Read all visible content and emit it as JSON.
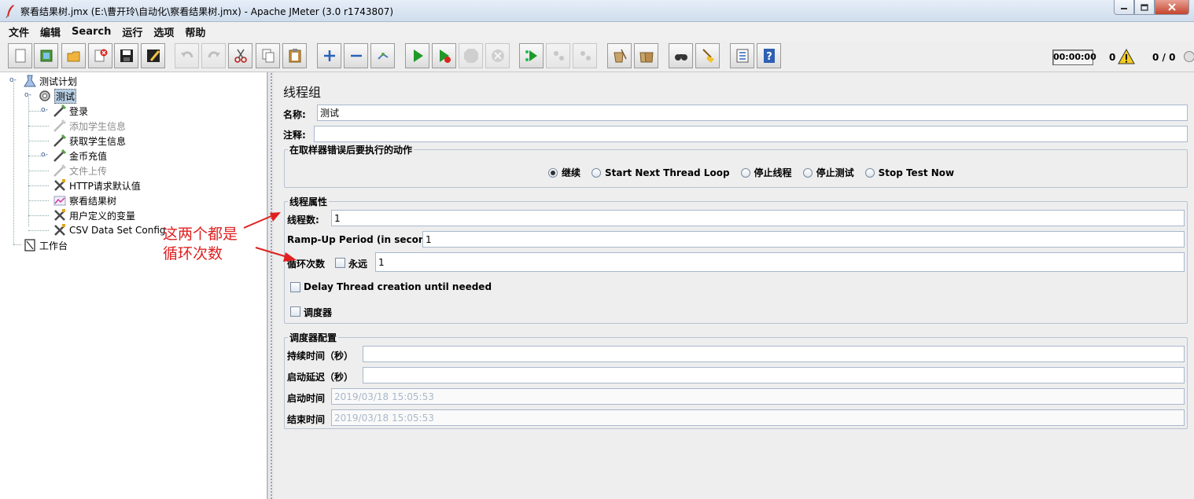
{
  "window": {
    "title": "察看结果树.jmx (E:\\曹开玲\\自动化\\察看结果树.jmx) - Apache JMeter (3.0 r1743807)",
    "minimize_icon": "minimize-icon",
    "maximize_icon": "maximize-icon",
    "close_icon": "close-icon"
  },
  "menu": [
    "文件",
    "编辑",
    "Search",
    "运行",
    "选项",
    "帮助"
  ],
  "toolbar": {
    "buttons": [
      {
        "name": "new-icon",
        "enabled": true
      },
      {
        "name": "templates-icon",
        "enabled": true
      },
      {
        "name": "open-icon",
        "enabled": true
      },
      {
        "name": "close-plan-icon",
        "enabled": true
      },
      {
        "name": "save-icon",
        "enabled": true
      },
      {
        "name": "save-as-icon",
        "enabled": true
      },
      {
        "name": "undo-icon",
        "enabled": false
      },
      {
        "name": "redo-icon",
        "enabled": false
      },
      {
        "name": "cut-icon",
        "enabled": true
      },
      {
        "name": "copy-icon",
        "enabled": true
      },
      {
        "name": "paste-icon",
        "enabled": true
      },
      {
        "name": "expand-icon",
        "enabled": true
      },
      {
        "name": "collapse-icon",
        "enabled": true
      },
      {
        "name": "toggle-icon",
        "enabled": true
      },
      {
        "name": "start-icon",
        "enabled": true
      },
      {
        "name": "start-no-pauses-icon",
        "enabled": true
      },
      {
        "name": "stop-icon",
        "enabled": false
      },
      {
        "name": "shutdown-icon",
        "enabled": false
      },
      {
        "name": "remote-start-icon",
        "enabled": true
      },
      {
        "name": "remote-stop-icon",
        "enabled": false
      },
      {
        "name": "remote-shutdown-icon",
        "enabled": false
      },
      {
        "name": "clear-icon",
        "enabled": true
      },
      {
        "name": "clear-all-icon",
        "enabled": true
      },
      {
        "name": "search-icon",
        "enabled": true
      },
      {
        "name": "reset-search-icon",
        "enabled": true
      },
      {
        "name": "function-helper-icon",
        "enabled": true
      },
      {
        "name": "help-icon",
        "enabled": true
      }
    ],
    "timer": "00:00:00",
    "warnings": "0",
    "threads": "0 / 0"
  },
  "tree": {
    "nodes": [
      {
        "label": "测试计划",
        "icon": "test-plan-icon",
        "state": "normal"
      },
      {
        "label": "测试",
        "icon": "thread-group-icon",
        "state": "selected"
      },
      {
        "label": "登录",
        "icon": "sampler-icon",
        "state": "normal"
      },
      {
        "label": "添加学生信息",
        "icon": "sampler-icon",
        "state": "disabled"
      },
      {
        "label": "获取学生信息",
        "icon": "sampler-icon",
        "state": "normal"
      },
      {
        "label": "金币充值",
        "icon": "sampler-icon",
        "state": "normal"
      },
      {
        "label": "文件上传",
        "icon": "sampler-icon",
        "state": "disabled"
      },
      {
        "label": "HTTP请求默认值",
        "icon": "config-icon",
        "state": "normal"
      },
      {
        "label": "察看结果树",
        "icon": "listener-icon",
        "state": "normal"
      },
      {
        "label": "用户定义的变量",
        "icon": "config-icon",
        "state": "normal"
      },
      {
        "label": "CSV Data Set Config",
        "icon": "config-icon",
        "state": "normal"
      },
      {
        "label": "工作台",
        "icon": "workbench-icon",
        "state": "normal"
      }
    ]
  },
  "thread_group": {
    "title": "线程组",
    "name_label": "名称:",
    "name_value": "测试",
    "comment_label": "注释:",
    "comment_value": "",
    "error_action": {
      "title": "在取样器错误后要执行的动作",
      "options": [
        "继续",
        "Start Next Thread Loop",
        "停止线程",
        "停止测试",
        "Stop Test Now"
      ],
      "selected_index": 0
    },
    "thread_props": {
      "title": "线程属性",
      "threads_label": "线程数:",
      "threads_value": "1",
      "rampup_label": "Ramp-Up Period (in seconds):",
      "rampup_value": "1",
      "loop_label": "循环次数",
      "forever_label": "永远",
      "forever_checked": false,
      "loop_value": "1",
      "delay_label": "Delay Thread creation until needed",
      "delay_checked": false,
      "scheduler_label": "调度器",
      "scheduler_checked": false
    },
    "scheduler_config": {
      "title": "调度器配置",
      "duration_label": "持续时间（秒）",
      "duration_value": "",
      "delay_label": "启动延迟（秒）",
      "delay_value": "",
      "start_label": "启动时间",
      "start_value": "2019/03/18 15:05:53",
      "end_label": "结束时间",
      "end_value": "2019/03/18 15:05:53"
    }
  },
  "annotation": {
    "line1": "这两个都是",
    "line2": "循环次数",
    "color": "#e02020"
  }
}
